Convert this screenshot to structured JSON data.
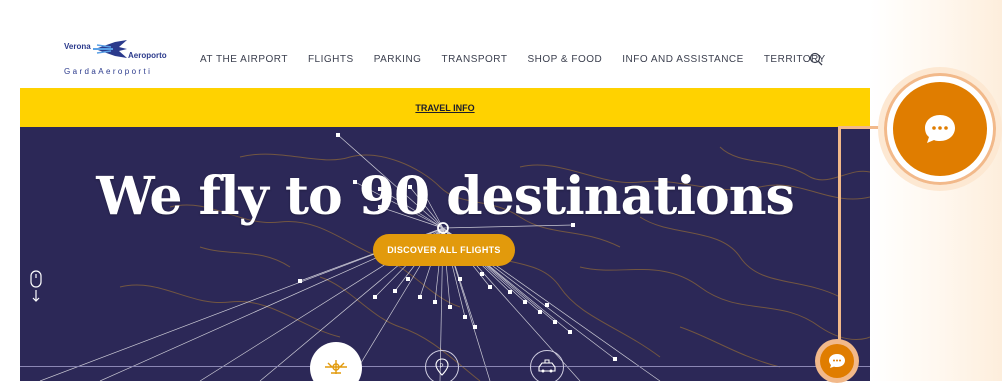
{
  "logo": {
    "word_top": "Verona",
    "word_right": "Aeroporto",
    "word_bottom": "GardaAeroporti"
  },
  "nav": {
    "items": [
      {
        "label": "AT THE AIRPORT"
      },
      {
        "label": "FLIGHTS"
      },
      {
        "label": "PARKING"
      },
      {
        "label": "TRANSPORT"
      },
      {
        "label": "SHOP & FOOD"
      },
      {
        "label": "INFO AND ASSISTANCE"
      },
      {
        "label": "TERRITORY"
      }
    ],
    "search_icon": "search-icon"
  },
  "travel_bar": {
    "link": "TRAVEL INFO",
    "background": "#ffd200"
  },
  "hero": {
    "title": "We fly to 90 destinations",
    "button_label": "DISCOVER ALL FLIGHTS",
    "background": "#2c2857",
    "button_color": "#e29a0c"
  },
  "chat": {
    "icon": "chat-bubble-icon",
    "color": "#e07d00"
  }
}
